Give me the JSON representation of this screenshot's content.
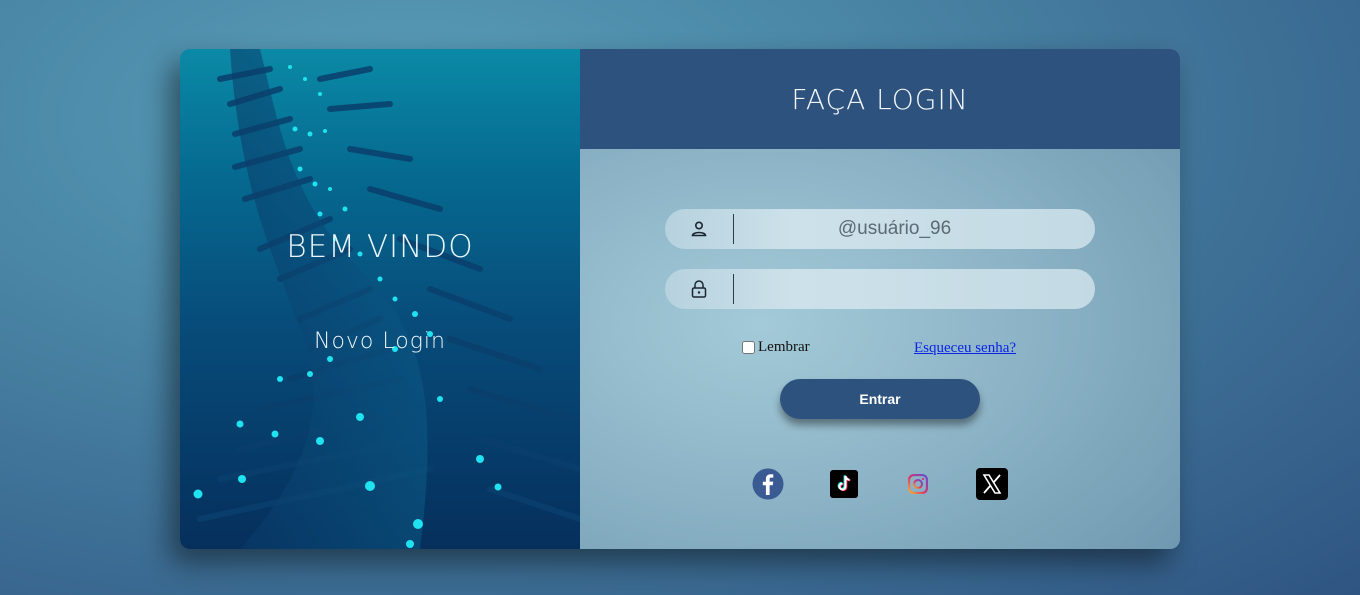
{
  "left_panel": {
    "welcome_text": "BEM VINDO",
    "new_login_link": "Novo Login"
  },
  "right_panel": {
    "title": "FAÇA LOGIN",
    "username_field": {
      "value": "",
      "placeholder": "@usuário_96",
      "icon": "user-icon"
    },
    "password_field": {
      "value": "",
      "placeholder": "",
      "icon": "lock-icon"
    },
    "remember_label": "Lembrar",
    "forgot_link": "Esqueceu senha?",
    "submit_label": "Entrar",
    "social": [
      {
        "name": "facebook",
        "icon": "facebook-icon",
        "color": "#3b5998"
      },
      {
        "name": "tiktok",
        "icon": "tiktok-icon",
        "color": "#000000"
      },
      {
        "name": "instagram",
        "icon": "instagram-icon",
        "color": "#e1306c"
      },
      {
        "name": "x",
        "icon": "x-icon",
        "color": "#000000"
      }
    ]
  },
  "colors": {
    "header_bg": "#2e527e",
    "button_bg": "#2e527e",
    "accent_cyan": "#1fe3f0"
  }
}
